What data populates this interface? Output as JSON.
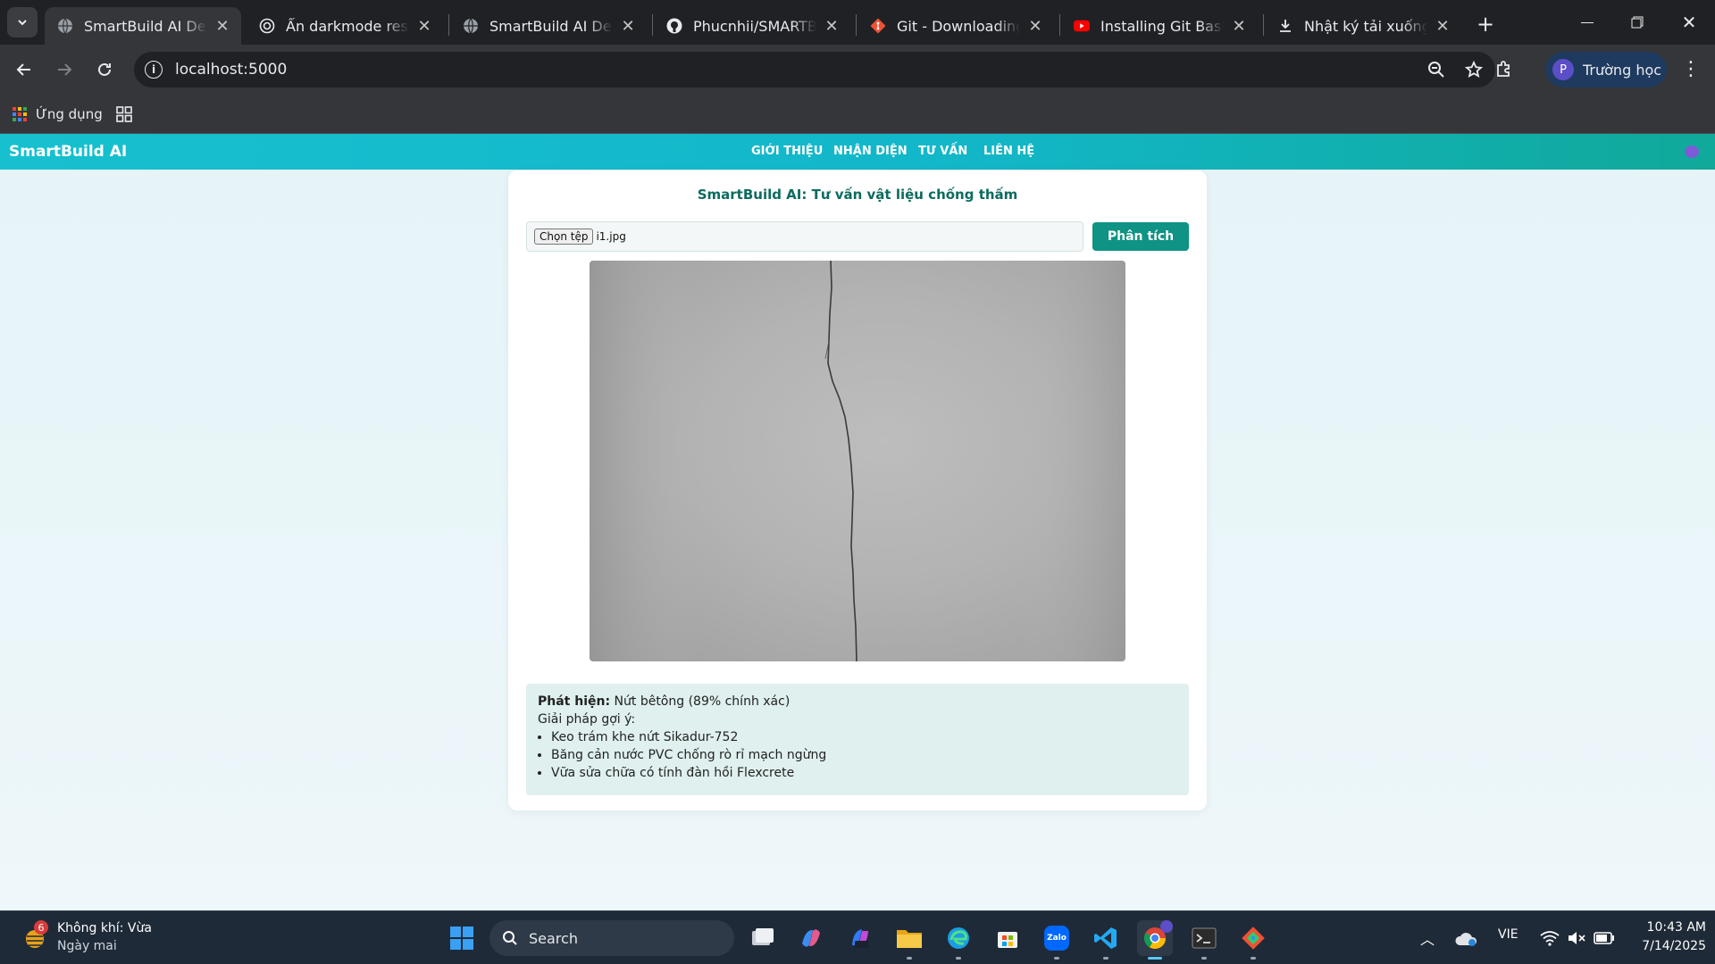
{
  "browser": {
    "tabs": [
      {
        "title": "SmartBuild AI Demo",
        "icon": "globe-icon",
        "active": true
      },
      {
        "title": "Ẩn darkmode respon",
        "icon": "openai-icon",
        "active": false
      },
      {
        "title": "SmartBuild AI Demo",
        "icon": "globe-icon",
        "active": false
      },
      {
        "title": "Phucnhii/SMARTBUIL",
        "icon": "github-icon",
        "active": false
      },
      {
        "title": "Git - Downloading Pa",
        "icon": "git-icon",
        "active": false
      },
      {
        "title": "Installing Git Bash on",
        "icon": "youtube-icon",
        "active": false
      },
      {
        "title": "Nhật ký tải xuống",
        "icon": "download-icon",
        "active": false
      }
    ],
    "url": "localhost:5000",
    "profile_initial": "P",
    "profile_label": "Trường học",
    "bookmarks": {
      "apps_label": "Ứng dụng"
    }
  },
  "site": {
    "brand": "SmartBuild AI",
    "nav": [
      "GIỚI THIỆU",
      "NHẬN DIỆN",
      "TƯ VẤN",
      "LIÊN HỆ"
    ],
    "title": "SmartBuild AI: Tư vấn vật liệu chống thấm",
    "file_button": "Chọn tệp",
    "file_name": "i1.jpg",
    "analyze_button": "Phân tích",
    "result": {
      "detect_label": "Phát hiện:",
      "detect_value": " Nứt bêtông (89% chính xác)",
      "suggest_label": "Giải pháp gợi ý:",
      "suggestions": [
        "Keo trám khe nứt Sikadur-752",
        "Băng cản nước PVC chống rò rỉ mạch ngừng",
        "Vữa sửa chữa có tính đàn hồi Flexcrete"
      ]
    }
  },
  "taskbar": {
    "weather_badge": "6",
    "weather_title": "Không khí: Vừa",
    "weather_sub": "Ngày mai",
    "search_placeholder": "Search",
    "language": "VIE",
    "time": "10:43 AM",
    "date": "7/14/2025"
  },
  "colors": {
    "accent": "#0e9384",
    "navbar": "#17c0cf",
    "title": "#0d6b5f",
    "result_bg": "#dff0ef"
  }
}
